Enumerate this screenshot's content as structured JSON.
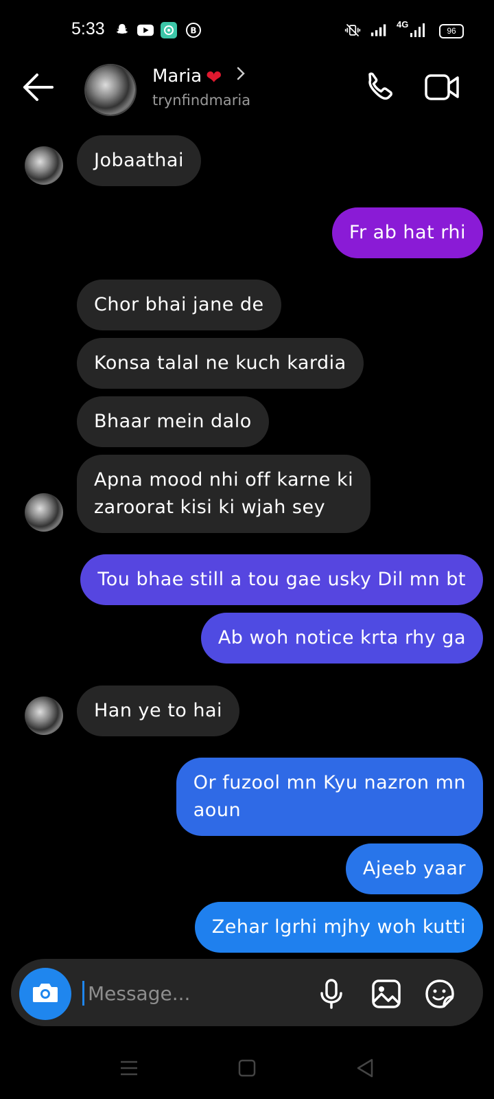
{
  "status_bar": {
    "time": "5:33",
    "network": "4G",
    "battery": "96"
  },
  "header": {
    "contact_name": "Maria",
    "heart": "❤",
    "username": "trynfindmaria"
  },
  "messages": [
    {
      "direction": "in",
      "text_lines": [
        "Jobaathai"
      ]
    },
    {
      "direction": "out",
      "text_lines": [
        "Fr ab hat rhi"
      ],
      "color": "#8a1bd6"
    },
    {
      "direction": "in",
      "text_lines": [
        "Chor bhai jane de"
      ]
    },
    {
      "direction": "in",
      "text_lines": [
        "Konsa talal ne kuch kardia"
      ]
    },
    {
      "direction": "in",
      "text_lines": [
        "Bhaar mein dalo"
      ]
    },
    {
      "direction": "in",
      "text_lines": [
        "Apna mood nhi off karne ki",
        "zaroorat kisi ki wjah sey"
      ]
    },
    {
      "direction": "out",
      "text_lines": [
        "Tou bhae still a tou gae usky Dil mn bt"
      ],
      "color": "#5646e0"
    },
    {
      "direction": "out",
      "text_lines": [
        "Ab woh notice krta rhy ga"
      ],
      "color": "#4f4be2"
    },
    {
      "direction": "in",
      "text_lines": [
        "Han ye to hai"
      ]
    },
    {
      "direction": "out",
      "text_lines": [
        "Or fuzool mn Kyu nazron mn",
        "aoun"
      ],
      "color": "#2f6ae6"
    },
    {
      "direction": "out",
      "text_lines": [
        "Ajeeb yaar"
      ],
      "color": "#2875ea"
    },
    {
      "direction": "out",
      "text_lines": [
        "Zehar lgrhi mjhy woh kutti"
      ],
      "color": "#1f80ee"
    }
  ],
  "composer": {
    "placeholder": "Message..."
  },
  "icons": {
    "back": "back-arrow-icon",
    "call": "phone-icon",
    "video": "video-camera-icon",
    "camera": "camera-icon",
    "mic": "microphone-icon",
    "gallery": "image-icon",
    "sticker": "sticker-icon"
  },
  "colors": {
    "accent": "#1f86ee",
    "incoming_bubble": "#262626",
    "background": "#000000"
  }
}
